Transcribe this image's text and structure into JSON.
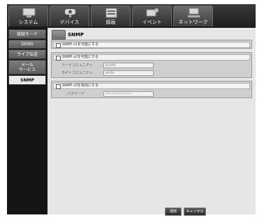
{
  "tabs": [
    {
      "label": "システム",
      "icon": "monitor-icon"
    },
    {
      "label": "デバイス",
      "icon": "camera-icon"
    },
    {
      "label": "録画",
      "icon": "recording-icon"
    },
    {
      "label": "イベント",
      "icon": "event-icon"
    },
    {
      "label": "ネットワーク",
      "icon": "network-icon"
    }
  ],
  "sidebar": {
    "items": [
      {
        "label": "接続モード"
      },
      {
        "label": "DDNS"
      },
      {
        "label": "ライブ伝送"
      },
      {
        "label": "メール\nサービス"
      },
      {
        "label": "SNMP"
      }
    ]
  },
  "main": {
    "title": "SNMP",
    "v1": {
      "label": "SNMP v1を可能にする"
    },
    "v2": {
      "label": "SNMP v2を可能にする",
      "read_label": "リードコミュニティ",
      "read_value": "public",
      "write_label": "ライトコミュニティ",
      "write_value": "write"
    },
    "v3": {
      "label": "SNMP v3を有効にする",
      "password_label": "パスワード",
      "password_value": "•••••••••••••"
    }
  },
  "buttons": {
    "apply": "適用",
    "cancel": "キャンセル"
  }
}
